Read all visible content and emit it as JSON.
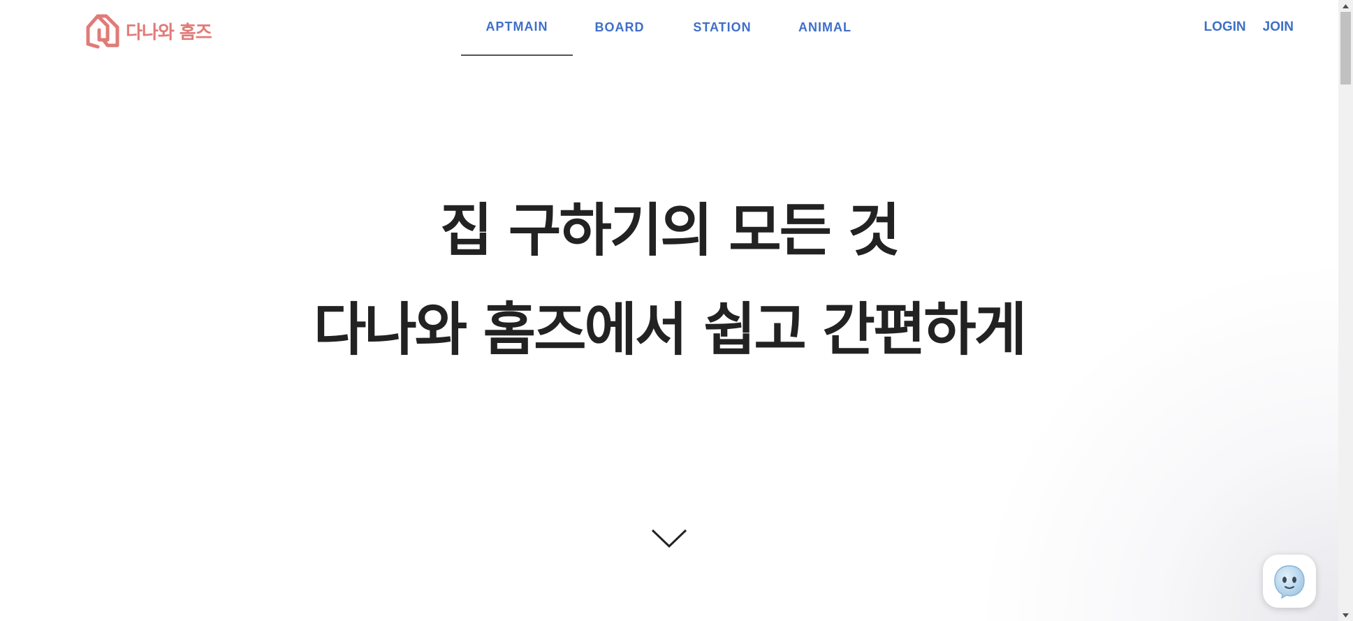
{
  "header": {
    "logo_text": "다나와 홈즈",
    "nav": [
      {
        "label": "APTMAIN",
        "active": true
      },
      {
        "label": "BOARD",
        "active": false
      },
      {
        "label": "STATION",
        "active": false
      },
      {
        "label": "ANIMAL",
        "active": false
      }
    ],
    "auth": {
      "login_label": "LOGIN",
      "join_label": "JOIN"
    }
  },
  "hero": {
    "line1": "집 구하기의 모든 것",
    "line2": "다나와 홈즈에서 쉽고 간편하게"
  },
  "icons": {
    "logo": "house-logo-icon",
    "scroll_down": "chevron-down-icon",
    "chat": "chatbot-ghost-icon"
  },
  "colors": {
    "brand": "#e07b78",
    "nav_link": "#3f6fc7",
    "hero_text": "#222222",
    "active_underline": "#555555"
  }
}
